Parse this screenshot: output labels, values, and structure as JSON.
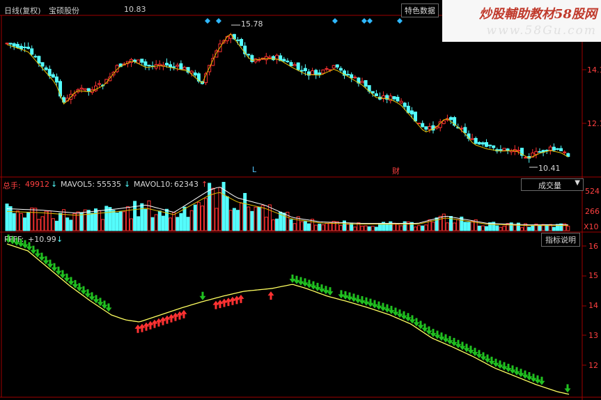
{
  "header": {
    "period": "日线(复权)",
    "stock_name": "宝硕股份",
    "price": "10.83",
    "feature_button": "特色数据"
  },
  "watermark": {
    "line1": "炒股輔助教材58股网",
    "line2": "www.58Gu.com"
  },
  "price_chart": {
    "high_label": "15.78",
    "low_label": "10.41",
    "right_ticks": [
      "14.1",
      "12.1"
    ],
    "markers": [
      "L",
      "财"
    ],
    "colors": {
      "up": "#ff3232",
      "down": "#54fcfc",
      "ma": "#e8c000"
    }
  },
  "volume_panel": {
    "total_label": "总手:",
    "total_value": "49912",
    "total_arrow": "↓",
    "ma5_label": "MAVOL5:",
    "ma5_value": "55535",
    "ma5_arrow": "↓",
    "ma10_label": "MAVOL10:",
    "ma10_value": "62343",
    "ma10_arrow": "↑",
    "dropdown_label": "成交量",
    "right_ticks": [
      "524",
      "266",
      "X10"
    ]
  },
  "indicator_panel": {
    "name_label": "FFFF:",
    "value": "+10.99",
    "arrow": "↓",
    "help_button": "指标说明",
    "right_ticks": [
      "16",
      "15",
      "14",
      "13",
      "12"
    ],
    "colors": {
      "line": "#ffff60",
      "buy": "#ff3232",
      "sell": "#20c020"
    }
  }
}
